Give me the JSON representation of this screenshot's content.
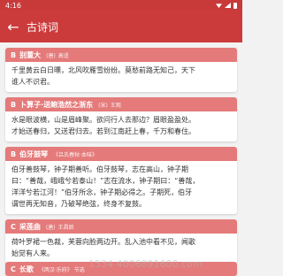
{
  "status": {
    "time": "4:16"
  },
  "appbar": {
    "title": "古诗词"
  },
  "poems": [
    {
      "letter": "B",
      "title": "别董大",
      "dynasty": "(唐)",
      "author": "高适",
      "lines": [
        "千里黄云白日曛，北风吹雁雪纷纷。莫愁前路无知己，天下",
        "谁人不识君。"
      ]
    },
    {
      "letter": "B",
      "title": "卜算子·送鲍浩然之浙东",
      "dynasty": "(宋)",
      "author": "王观",
      "lines": [
        "水是眼波横，山是眉峰聚。欲问行人去那边？眉眼盈盈处。",
        "才始送春归，又送君归去。若到江南赶上春，千万和春住。"
      ]
    },
    {
      "letter": "B",
      "title": "伯牙鼓琴",
      "dynasty": "",
      "author": "《吕氏春秋·本味》",
      "lines": [
        "伯牙善鼓琴，钟子期善听。伯牙鼓琴，志在高山，钟子期",
        "曰：“善哉，峨峨兮若泰山！”志在流水，钟子期曰：“善哉，",
        "洋洋兮若江河！”伯牙所念，钟子期必得之。子期死，伯牙",
        "谓世再无知音，乃破琴绝弦，终身不复鼓。"
      ]
    },
    {
      "letter": "C",
      "title": "采莲曲",
      "dynasty": "(唐)",
      "author": "王昌龄",
      "lines": [
        "荷叶罗裙一色裁，芙蓉向脸两边开。乱入池中看不见，闻歌",
        "始觉有人来。"
      ]
    },
    {
      "letter": "C",
      "title": "长歌",
      "dynasty": "",
      "author": "《两汉·乐府》 节选",
      "lines": []
    }
  ],
  "watermark": "1534 4006891600.com"
}
